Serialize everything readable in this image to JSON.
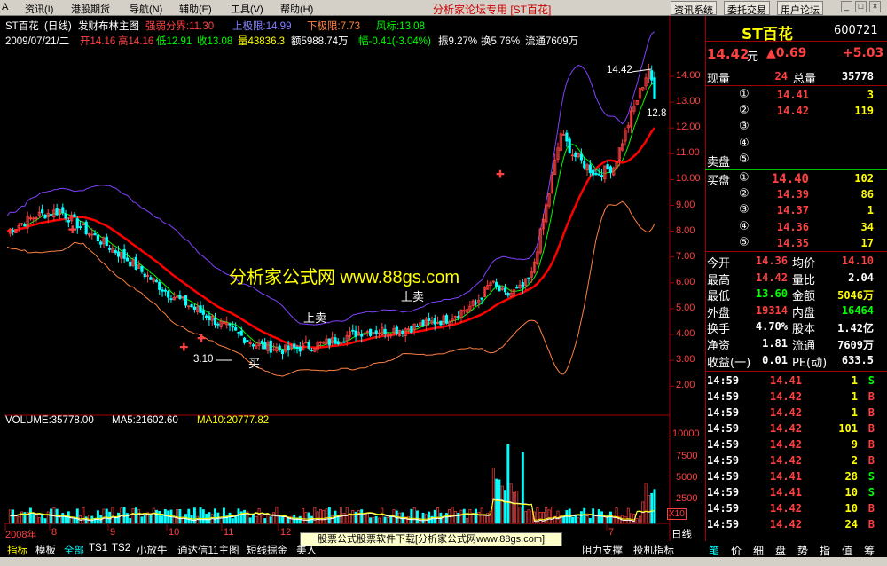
{
  "menu": [
    "资讯(I)",
    "港股期货",
    "导航(N)",
    "辅助(E)",
    "工具(V)",
    "帮助(H)"
  ],
  "forum_title": "分析家论坛专用 [ST百花]",
  "top_buttons": [
    "资讯系统",
    "委托交易",
    "用户论坛"
  ],
  "header": {
    "line1": {
      "name": "ST百花",
      "period": "(日线)",
      "indicator": "发财布林主图",
      "strength": "强弱分界:11.30",
      "upper": "上极限:14.99",
      "lower": "下极限:7.73",
      "wind": "风标:13.08"
    },
    "line2": {
      "date": "2009/07/21/二",
      "open": "开14.16",
      "high": "高14.16",
      "low": "低12.91",
      "close": "收13.08",
      "volume": "量43836.3",
      "amount": "额5988.74万",
      "change": "幅-0.41(-3.04%)",
      "amplitude": "振9.27%",
      "turnover": "换5.76%",
      "float": "流通7609万"
    }
  },
  "vol_header": {
    "vol": "VOLUME:35778.00",
    "ma5": "MA5:21602.60",
    "ma10": "MA10:20777.82"
  },
  "price_axis": [
    "14.00",
    "13.00",
    "12.00",
    "11.00",
    "10.00",
    "9.00",
    "8.00",
    "7.00",
    "6.00",
    "5.00",
    "4.00",
    "3.00",
    "2.00"
  ],
  "vol_axis": [
    "10000",
    "7500",
    "5000",
    "2500"
  ],
  "vol_multiplier": "X10",
  "time_axis": [
    "2008年",
    "8",
    "9",
    "10",
    "11",
    "12",
    "7"
  ],
  "annotations": {
    "low_price": "3.10",
    "buy": "买",
    "sell1": "上卖",
    "sell2": "上卖",
    "high_price": "14.42",
    "right_price": "12.8"
  },
  "watermark": "分析家公式网  www.88gs.com",
  "quote": {
    "name": "ST百花",
    "code": "600721",
    "price": "14.42",
    "unit": "元",
    "change": "▲0.69",
    "change_pct": "+5.03",
    "current_vol_label": "现量",
    "current_vol": "24",
    "total_vol_label": "总量",
    "total_vol": "35778",
    "sell_label": "卖盘",
    "buy_label": "买盘",
    "asks": [
      {
        "level": "⑤",
        "price": "",
        "vol": ""
      },
      {
        "level": "④",
        "price": "",
        "vol": ""
      },
      {
        "level": "③",
        "price": "",
        "vol": ""
      },
      {
        "level": "②",
        "price": "14.42",
        "vol": "119"
      },
      {
        "level": "①",
        "price": "14.41",
        "vol": "3"
      }
    ],
    "bids": [
      {
        "level": "①",
        "price": "14.40",
        "vol": "102"
      },
      {
        "level": "②",
        "price": "14.39",
        "vol": "86"
      },
      {
        "level": "③",
        "price": "14.37",
        "vol": "1"
      },
      {
        "level": "④",
        "price": "14.36",
        "vol": "34"
      },
      {
        "level": "⑤",
        "price": "14.35",
        "vol": "17"
      }
    ],
    "stats": [
      {
        "l1": "今开",
        "v1": "14.36",
        "c1": "#ff4040",
        "l2": "均价",
        "v2": "14.10",
        "c2": "#ff4040"
      },
      {
        "l1": "最高",
        "v1": "14.42",
        "c1": "#ff4040",
        "l2": "量比",
        "v2": "2.04",
        "c2": "#ffffff"
      },
      {
        "l1": "最低",
        "v1": "13.60",
        "c1": "#00ff00",
        "l2": "金额",
        "v2": "5046万",
        "c2": "#ffff00"
      },
      {
        "l1": "外盘",
        "v1": "19314",
        "c1": "#ff4040",
        "l2": "内盘",
        "v2": "16464",
        "c2": "#00ff00"
      },
      {
        "l1": "换手",
        "v1": "4.70%",
        "c1": "#ffffff",
        "l2": "股本",
        "v2": "1.42亿",
        "c2": "#ffffff"
      },
      {
        "l1": "净资",
        "v1": "1.81",
        "c1": "#ffffff",
        "l2": "流通",
        "v2": "7609万",
        "c2": "#ffffff"
      },
      {
        "l1": "收益(一)",
        "v1": "0.01",
        "c1": "#ffffff",
        "l2": "PE(动)",
        "v2": "633.5",
        "c2": "#ffffff"
      }
    ],
    "ticks": [
      {
        "time": "14:59",
        "price": "14.41",
        "vol": "1",
        "side": "S"
      },
      {
        "time": "14:59",
        "price": "14.42",
        "vol": "1",
        "side": "B"
      },
      {
        "time": "14:59",
        "price": "14.42",
        "vol": "1",
        "side": "B"
      },
      {
        "time": "14:59",
        "price": "14.42",
        "vol": "101",
        "side": "B"
      },
      {
        "time": "14:59",
        "price": "14.42",
        "vol": "9",
        "side": "B"
      },
      {
        "time": "14:59",
        "price": "14.42",
        "vol": "2",
        "side": "B"
      },
      {
        "time": "14:59",
        "price": "14.41",
        "vol": "28",
        "side": "S"
      },
      {
        "time": "14:59",
        "price": "14.41",
        "vol": "10",
        "side": "S"
      },
      {
        "time": "14:59",
        "price": "14.42",
        "vol": "10",
        "side": "B"
      },
      {
        "time": "14:59",
        "price": "14.42",
        "vol": "24",
        "side": "B"
      }
    ]
  },
  "period_label": "日线",
  "bottom_tabs": [
    "指标",
    "模板",
    "全部",
    "TS1",
    "TS2",
    "小放牛",
    "通达信11主图",
    "短线掘金",
    "美人",
    "",
    "",
    "",
    "",
    "",
    "",
    "",
    "阻力支撑",
    "投机指标"
  ],
  "banner": "股票公式股票软件下载[分析家公式网www.88gs.com]",
  "right_tabs": [
    "笔",
    "价",
    "细",
    "盘",
    "势",
    "指",
    "值",
    "筹"
  ],
  "colors": {
    "up": "#ff4040",
    "down": "#00ffff",
    "ma": "#ff0000",
    "upper_band": "#8040ff",
    "lower_band": "#ff8040",
    "mid": "#00ff00"
  }
}
